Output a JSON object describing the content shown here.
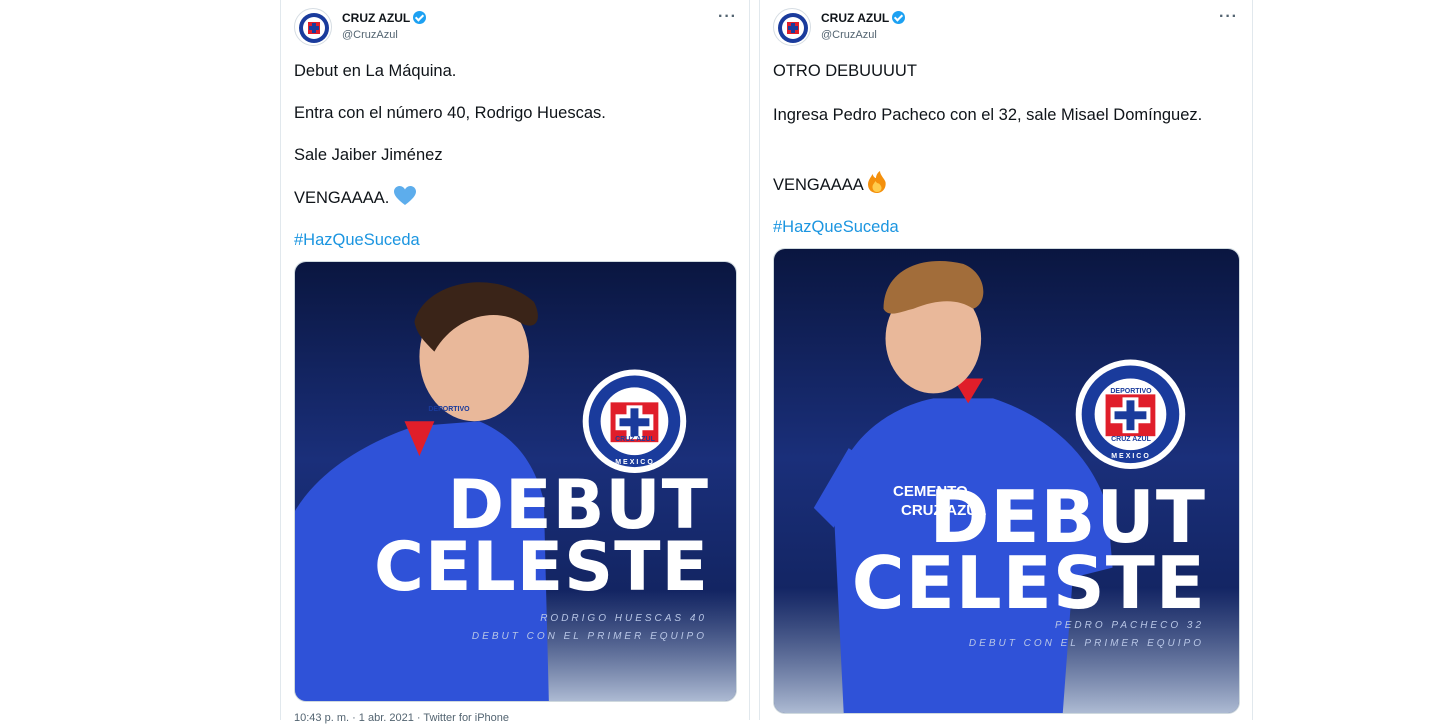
{
  "tweets": [
    {
      "author": "CRUZ AZUL",
      "handle": "@CruzAzul",
      "more": "···",
      "lines": [
        "Debut en La Máquina.",
        "Entra con el número 40, Rodrigo Huescas.",
        "Sale Jaiber Jiménez",
        "VENGAAAA."
      ],
      "emoji": "blue-heart-icon",
      "hashtag": "#HazQueSuceda",
      "image": {
        "headline1": "DEBUT",
        "headline2": "CELESTE",
        "caption1": "RODRIGO HUESCAS 40",
        "caption2": "DEBUT CON EL PRIMER EQUIPO",
        "crest_top": "DEPORTIVO",
        "crest_bottom": "CRUZ AZUL",
        "crest_ring": "MEXICO"
      },
      "footer": "10:43 p. m. · 1 abr. 2021 · Twitter for iPhone"
    },
    {
      "author": "CRUZ AZUL",
      "handle": "@CruzAzul",
      "more": "···",
      "lines": [
        "OTRO DEBUUUUT",
        "Ingresa Pedro Pacheco con el 32, sale Misael Domínguez.",
        "VENGAAAA"
      ],
      "emoji": "fire-icon",
      "hashtag": "#HazQueSuceda",
      "image": {
        "headline1": "DEBUT",
        "headline2": "CELESTE",
        "caption1": "PEDRO PACHECO 32",
        "caption2": "DEBUT CON EL PRIMER EQUIPO",
        "crest_top": "DEPORTIVO",
        "crest_bottom": "CRUZ AZUL",
        "crest_ring": "MEXICO",
        "shirt_sponsor1": "CEMENTO",
        "shirt_sponsor2": "CRUZ AZUL"
      }
    }
  ],
  "colors": {
    "accent": "#1b95e0",
    "verified": "#1da1f2",
    "poster_bg": "#0d1c4f",
    "jersey": "#2f52d8",
    "crest_red": "#e01e2a"
  }
}
